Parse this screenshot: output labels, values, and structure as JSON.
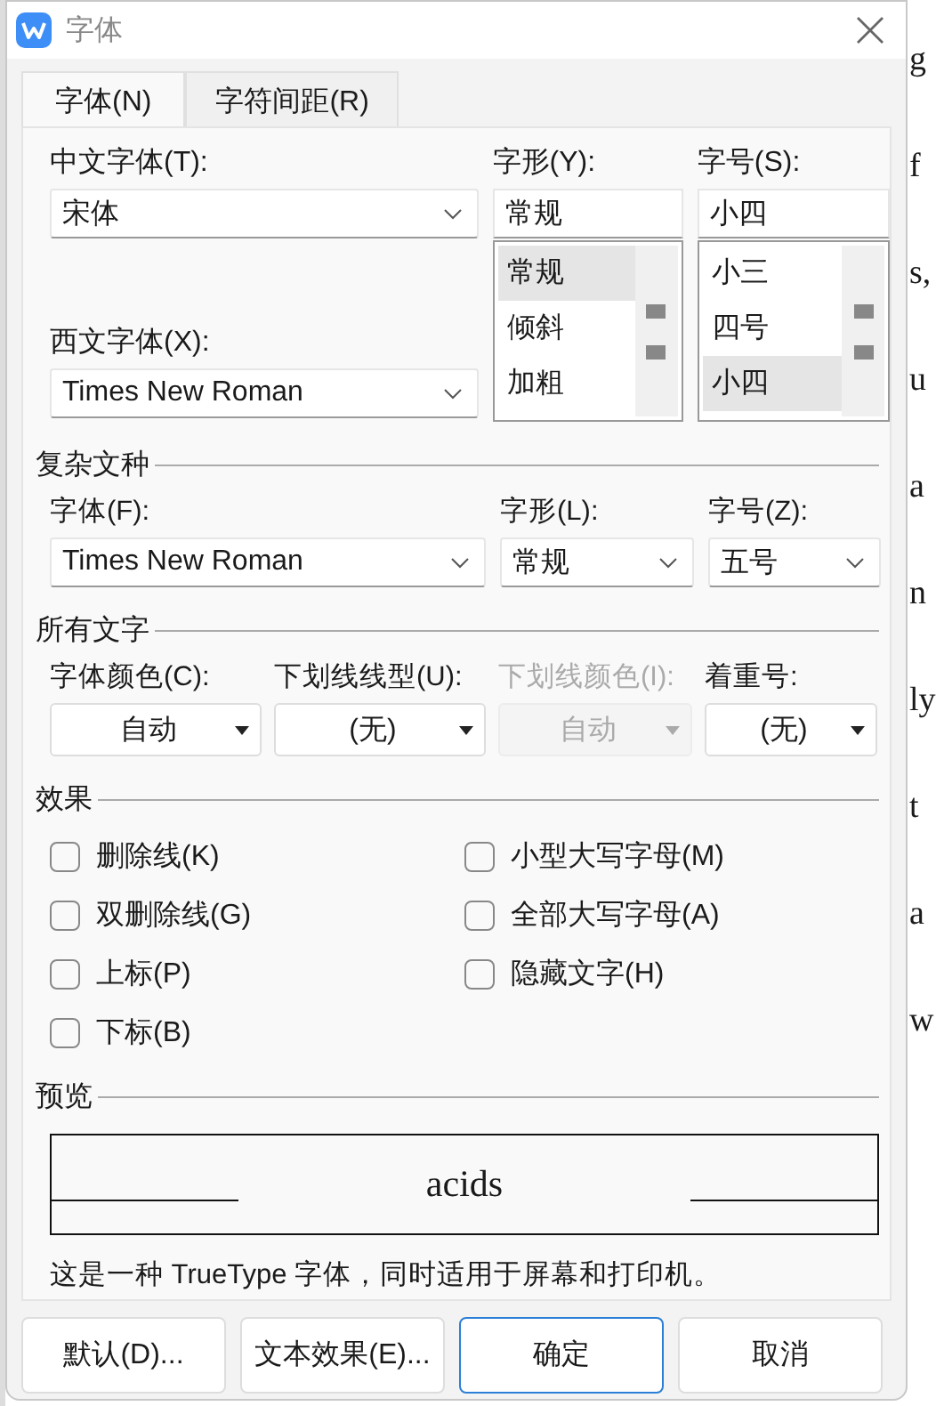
{
  "window": {
    "title": "字体"
  },
  "tabs": [
    {
      "label": "字体(N)",
      "selected": true
    },
    {
      "label": "字符间距(R)",
      "selected": false
    }
  ],
  "chinese_font": {
    "label": "中文字体(T):",
    "value": "宋体"
  },
  "style": {
    "label": "字形(Y):",
    "value": "常规",
    "options": [
      {
        "label": "常规",
        "selected": true
      },
      {
        "label": "倾斜",
        "selected": false
      },
      {
        "label": "加粗",
        "selected": false
      }
    ]
  },
  "size": {
    "label": "字号(S):",
    "value": "小四",
    "options": [
      {
        "label": "小三",
        "selected": false
      },
      {
        "label": "四号",
        "selected": false
      },
      {
        "label": "小四",
        "selected": true
      }
    ]
  },
  "western_font": {
    "label": "西文字体(X):",
    "value": "Times New Roman"
  },
  "complex_script": {
    "title": "复杂文种",
    "fields": [
      {
        "label": "字体(F):",
        "value": "Times New Roman"
      },
      {
        "label": "字形(L):",
        "value": "常规"
      },
      {
        "label": "字号(Z):",
        "value": "五号"
      }
    ]
  },
  "all_text": {
    "title": "所有文字",
    "fields": [
      {
        "label": "字体颜色(C):",
        "value": "自动",
        "disabled": false
      },
      {
        "label": "下划线线型(U):",
        "value": "(无)",
        "disabled": false
      },
      {
        "label": "下划线颜色(I):",
        "value": "自动",
        "disabled": true
      },
      {
        "label": "着重号:",
        "value": "(无)",
        "disabled": false
      }
    ]
  },
  "effects": {
    "title": "效果",
    "options": [
      {
        "label": "删除线(K)",
        "checked": false
      },
      {
        "label": "小型大写字母(M)",
        "checked": false
      },
      {
        "label": "双删除线(G)",
        "checked": false
      },
      {
        "label": "全部大写字母(A)",
        "checked": false
      },
      {
        "label": "上标(P)",
        "checked": false
      },
      {
        "label": "隐藏文字(H)",
        "checked": false
      },
      {
        "label": "下标(B)",
        "checked": false
      }
    ]
  },
  "preview": {
    "title": "预览",
    "sample": "acids",
    "note": "这是一种 TrueType 字体，同时适用于屏幕和打印机。"
  },
  "buttons": [
    {
      "label": "默认(D)...",
      "primary": false
    },
    {
      "label": "文本效果(E)...",
      "primary": false
    },
    {
      "label": "确定",
      "primary": true
    },
    {
      "label": "取消",
      "primary": false
    }
  ],
  "background_text": [
    "g",
    "f",
    "s,",
    "u",
    "a",
    "n",
    "ly",
    "t",
    "a",
    "w"
  ]
}
